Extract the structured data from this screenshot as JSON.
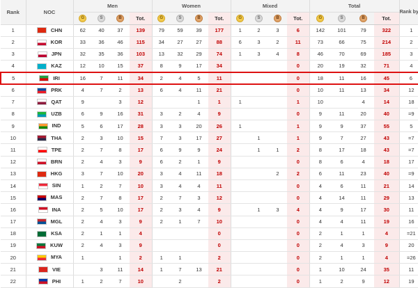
{
  "header": {
    "rank": "Rank",
    "noc": "NOC",
    "groups": [
      "Men",
      "Women",
      "Mixed",
      "Total"
    ],
    "rank_by_total": "Rank by Total",
    "medal_letters": [
      "G",
      "S",
      "B"
    ],
    "tot": "Tot."
  },
  "highlight_row_index": 4,
  "rows": [
    {
      "rank": "1",
      "noc": "CHN",
      "flag": [
        "#de2910",
        "#de2910"
      ],
      "men": [
        "62",
        "40",
        "37",
        "139"
      ],
      "women": [
        "79",
        "59",
        "39",
        "177"
      ],
      "mixed": [
        "1",
        "2",
        "3",
        "6"
      ],
      "total": [
        "142",
        "101",
        "79",
        "322"
      ],
      "rbt": "1"
    },
    {
      "rank": "2",
      "noc": "KOR",
      "flag": [
        "#ffffff",
        "#c60c30"
      ],
      "men": [
        "33",
        "36",
        "46",
        "115"
      ],
      "women": [
        "34",
        "27",
        "27",
        "88"
      ],
      "mixed": [
        "6",
        "3",
        "2",
        "11"
      ],
      "total": [
        "73",
        "66",
        "75",
        "214"
      ],
      "rbt": "2"
    },
    {
      "rank": "3",
      "noc": "JPN",
      "flag": [
        "#ffffff",
        "#bc002d"
      ],
      "men": [
        "32",
        "35",
        "36",
        "103"
      ],
      "women": [
        "13",
        "32",
        "29",
        "74"
      ],
      "mixed": [
        "1",
        "3",
        "4",
        "8"
      ],
      "total": [
        "46",
        "70",
        "69",
        "185"
      ],
      "rbt": "3"
    },
    {
      "rank": "4",
      "noc": "KAZ",
      "flag": [
        "#00afca",
        "#00afca"
      ],
      "men": [
        "12",
        "10",
        "15",
        "37"
      ],
      "women": [
        "8",
        "9",
        "17",
        "34"
      ],
      "mixed": [
        "",
        "",
        "",
        "0"
      ],
      "total": [
        "20",
        "19",
        "32",
        "71"
      ],
      "rbt": "4"
    },
    {
      "rank": "5",
      "noc": "IRI",
      "flag": [
        "#239f40",
        "#da0000"
      ],
      "men": [
        "16",
        "7",
        "11",
        "34"
      ],
      "women": [
        "2",
        "4",
        "5",
        "11"
      ],
      "mixed": [
        "",
        "",
        "",
        "0"
      ],
      "total": [
        "18",
        "11",
        "16",
        "45"
      ],
      "rbt": "6"
    },
    {
      "rank": "6",
      "noc": "PRK",
      "flag": [
        "#024fa2",
        "#ed1c27"
      ],
      "men": [
        "4",
        "7",
        "2",
        "13"
      ],
      "women": [
        "6",
        "4",
        "11",
        "21"
      ],
      "mixed": [
        "",
        "",
        "",
        "0"
      ],
      "total": [
        "10",
        "11",
        "13",
        "34"
      ],
      "rbt": "12"
    },
    {
      "rank": "7",
      "noc": "QAT",
      "flag": [
        "#ffffff",
        "#8d1b3d"
      ],
      "men": [
        "9",
        "",
        "3",
        "12"
      ],
      "women": [
        "",
        "",
        "1",
        "1"
      ],
      "mixed": [
        "1",
        "",
        "",
        "1"
      ],
      "total": [
        "10",
        "",
        "4",
        "14"
      ],
      "rbt": "18"
    },
    {
      "rank": "8",
      "noc": "UZB",
      "flag": [
        "#1eb53a",
        "#0099b5"
      ],
      "men": [
        "6",
        "9",
        "16",
        "31"
      ],
      "women": [
        "3",
        "2",
        "4",
        "9"
      ],
      "mixed": [
        "",
        "",
        "",
        "0"
      ],
      "total": [
        "9",
        "11",
        "20",
        "40"
      ],
      "rbt": "=9"
    },
    {
      "rank": "9",
      "noc": "IND",
      "flag": [
        "#ff9933",
        "#138808"
      ],
      "men": [
        "5",
        "6",
        "17",
        "28"
      ],
      "women": [
        "3",
        "3",
        "20",
        "26"
      ],
      "mixed": [
        "1",
        "",
        "",
        "1"
      ],
      "total": [
        "9",
        "9",
        "37",
        "55"
      ],
      "rbt": "5"
    },
    {
      "rank": "10",
      "noc": "THA",
      "flag": [
        "#a51931",
        "#2d2a4a"
      ],
      "men": [
        "2",
        "3",
        "10",
        "15"
      ],
      "women": [
        "7",
        "3",
        "17",
        "27"
      ],
      "mixed": [
        "",
        "1",
        "",
        "1"
      ],
      "total": [
        "9",
        "7",
        "27",
        "43"
      ],
      "rbt": "=7"
    },
    {
      "rank": "11",
      "noc": "TPE",
      "flag": [
        "#ffffff",
        "#fe0000"
      ],
      "men": [
        "2",
        "7",
        "8",
        "17"
      ],
      "women": [
        "6",
        "9",
        "9",
        "24"
      ],
      "mixed": [
        "",
        "1",
        "1",
        "2"
      ],
      "total": [
        "8",
        "17",
        "18",
        "43"
      ],
      "rbt": "=7"
    },
    {
      "rank": "12",
      "noc": "BRN",
      "flag": [
        "#ffffff",
        "#ce1126"
      ],
      "men": [
        "2",
        "4",
        "3",
        "9"
      ],
      "women": [
        "6",
        "2",
        "1",
        "9"
      ],
      "mixed": [
        "",
        "",
        "",
        "0"
      ],
      "total": [
        "8",
        "6",
        "4",
        "18"
      ],
      "rbt": "17"
    },
    {
      "rank": "13",
      "noc": "HKG",
      "flag": [
        "#de2910",
        "#de2910"
      ],
      "men": [
        "3",
        "7",
        "10",
        "20"
      ],
      "women": [
        "3",
        "4",
        "11",
        "18"
      ],
      "mixed": [
        "",
        "",
        "2",
        "2"
      ],
      "total": [
        "6",
        "11",
        "23",
        "40"
      ],
      "rbt": "=9"
    },
    {
      "rank": "14",
      "noc": "SIN",
      "flag": [
        "#ed2939",
        "#ffffff"
      ],
      "men": [
        "1",
        "2",
        "7",
        "10"
      ],
      "women": [
        "3",
        "4",
        "4",
        "11"
      ],
      "mixed": [
        "",
        "",
        "",
        "0"
      ],
      "total": [
        "4",
        "6",
        "11",
        "21"
      ],
      "rbt": "14"
    },
    {
      "rank": "15",
      "noc": "MAS",
      "flag": [
        "#cc0001",
        "#010066"
      ],
      "men": [
        "2",
        "7",
        "8",
        "17"
      ],
      "women": [
        "2",
        "7",
        "3",
        "12"
      ],
      "mixed": [
        "",
        "",
        "",
        "0"
      ],
      "total": [
        "4",
        "14",
        "11",
        "29"
      ],
      "rbt": "13"
    },
    {
      "rank": "16",
      "noc": "INA",
      "flag": [
        "#ce1126",
        "#ffffff"
      ],
      "men": [
        "2",
        "5",
        "10",
        "17"
      ],
      "women": [
        "2",
        "3",
        "4",
        "9"
      ],
      "mixed": [
        "",
        "1",
        "3",
        "4"
      ],
      "total": [
        "4",
        "9",
        "17",
        "30"
      ],
      "rbt": "11"
    },
    {
      "rank": "17",
      "noc": "MGL",
      "flag": [
        "#c4272f",
        "#015197"
      ],
      "men": [
        "2",
        "4",
        "3",
        "9"
      ],
      "women": [
        "2",
        "1",
        "7",
        "10"
      ],
      "mixed": [
        "",
        "",
        "",
        "0"
      ],
      "total": [
        "4",
        "4",
        "11",
        "19"
      ],
      "rbt": "16"
    },
    {
      "rank": "18",
      "noc": "KSA",
      "flag": [
        "#006c35",
        "#006c35"
      ],
      "men": [
        "2",
        "1",
        "1",
        "4"
      ],
      "women": [
        "",
        "",
        "",
        "0"
      ],
      "mixed": [
        "",
        "",
        "",
        "0"
      ],
      "total": [
        "2",
        "1",
        "1",
        "4"
      ],
      "rbt": "=21"
    },
    {
      "rank": "19",
      "noc": "KUW",
      "flag": [
        "#007a3d",
        "#ce1126"
      ],
      "men": [
        "2",
        "4",
        "3",
        "9"
      ],
      "women": [
        "",
        "",
        "",
        "0"
      ],
      "mixed": [
        "",
        "",
        "",
        "0"
      ],
      "total": [
        "2",
        "4",
        "3",
        "9"
      ],
      "rbt": "20"
    },
    {
      "rank": "20",
      "noc": "MYA",
      "flag": [
        "#fecb00",
        "#ea2839"
      ],
      "men": [
        "1",
        "",
        "1",
        "2"
      ],
      "women": [
        "1",
        "1",
        "",
        "2"
      ],
      "mixed": [
        "",
        "",
        "",
        "0"
      ],
      "total": [
        "2",
        "1",
        "1",
        "4"
      ],
      "rbt": "=26"
    },
    {
      "rank": "21",
      "noc": "VIE",
      "flag": [
        "#da251d",
        "#da251d"
      ],
      "men": [
        "",
        "3",
        "11",
        "14"
      ],
      "women": [
        "1",
        "7",
        "13",
        "21"
      ],
      "mixed": [
        "",
        "",
        "",
        "0"
      ],
      "total": [
        "1",
        "10",
        "24",
        "35"
      ],
      "rbt": "11"
    },
    {
      "rank": "22",
      "noc": "PHI",
      "flag": [
        "#0038a8",
        "#ce1126"
      ],
      "men": [
        "1",
        "2",
        "7",
        "10"
      ],
      "women": [
        "",
        "2",
        "",
        "2"
      ],
      "mixed": [
        "",
        "",
        "",
        "0"
      ],
      "total": [
        "1",
        "2",
        "9",
        "12"
      ],
      "rbt": "19"
    }
  ]
}
